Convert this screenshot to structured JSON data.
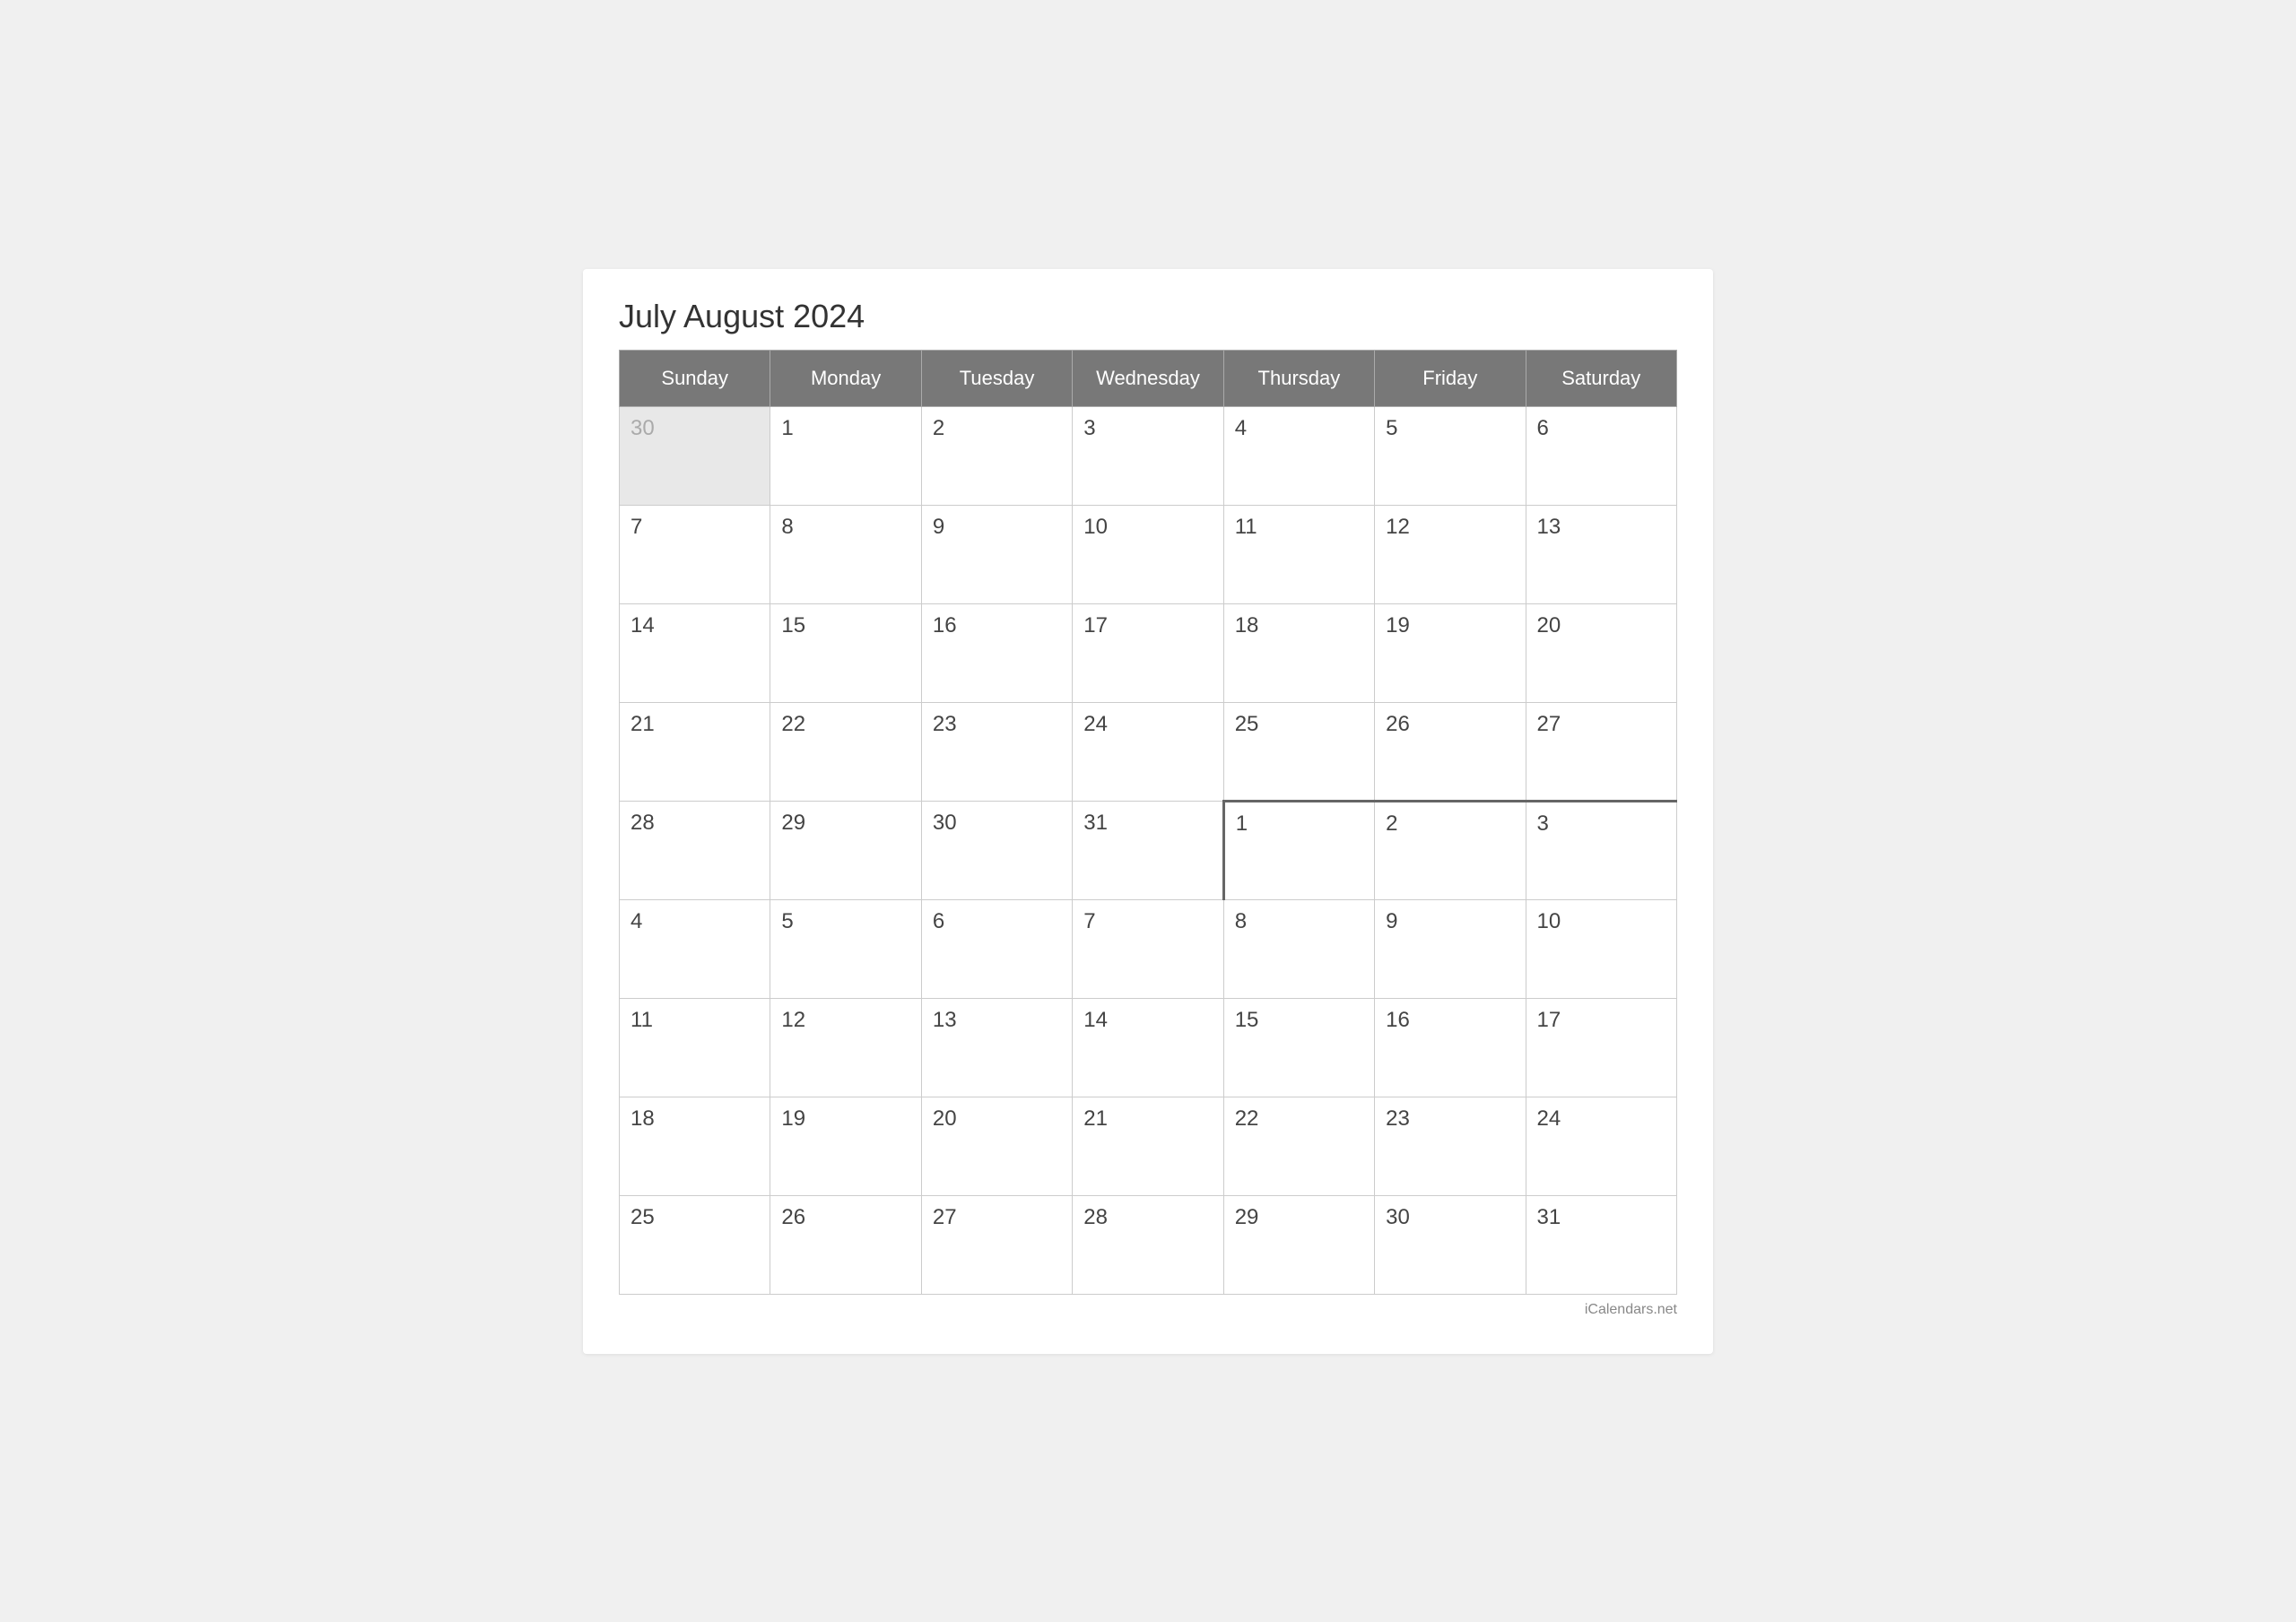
{
  "title": "July August 2024",
  "watermark": "iCalendars.net",
  "headers": [
    "Sunday",
    "Monday",
    "Tuesday",
    "Wednesday",
    "Thursday",
    "Friday",
    "Saturday"
  ],
  "weeks": [
    {
      "days": [
        {
          "num": "30",
          "type": "prev-month"
        },
        {
          "num": "1",
          "type": "current"
        },
        {
          "num": "2",
          "type": "current"
        },
        {
          "num": "3",
          "type": "current"
        },
        {
          "num": "4",
          "type": "current"
        },
        {
          "num": "5",
          "type": "current"
        },
        {
          "num": "6",
          "type": "current"
        }
      ]
    },
    {
      "days": [
        {
          "num": "7",
          "type": "current"
        },
        {
          "num": "8",
          "type": "current"
        },
        {
          "num": "9",
          "type": "current"
        },
        {
          "num": "10",
          "type": "current"
        },
        {
          "num": "11",
          "type": "current"
        },
        {
          "num": "12",
          "type": "current"
        },
        {
          "num": "13",
          "type": "current"
        }
      ]
    },
    {
      "days": [
        {
          "num": "14",
          "type": "current"
        },
        {
          "num": "15",
          "type": "current"
        },
        {
          "num": "16",
          "type": "current"
        },
        {
          "num": "17",
          "type": "current"
        },
        {
          "num": "18",
          "type": "current"
        },
        {
          "num": "19",
          "type": "current"
        },
        {
          "num": "20",
          "type": "current"
        }
      ]
    },
    {
      "days": [
        {
          "num": "21",
          "type": "current"
        },
        {
          "num": "22",
          "type": "current"
        },
        {
          "num": "23",
          "type": "current"
        },
        {
          "num": "24",
          "type": "current"
        },
        {
          "num": "25",
          "type": "current"
        },
        {
          "num": "26",
          "type": "current"
        },
        {
          "num": "27",
          "type": "current"
        }
      ]
    },
    {
      "days": [
        {
          "num": "28",
          "type": "current"
        },
        {
          "num": "29",
          "type": "current"
        },
        {
          "num": "30",
          "type": "current"
        },
        {
          "num": "31",
          "type": "current",
          "divider-right": true
        },
        {
          "num": "1",
          "type": "next-month",
          "divider-top": true
        },
        {
          "num": "2",
          "type": "next-month",
          "divider-top": true
        },
        {
          "num": "3",
          "type": "next-month",
          "divider-top": true
        }
      ]
    },
    {
      "days": [
        {
          "num": "4",
          "type": "next-month"
        },
        {
          "num": "5",
          "type": "next-month"
        },
        {
          "num": "6",
          "type": "next-month"
        },
        {
          "num": "7",
          "type": "next-month"
        },
        {
          "num": "8",
          "type": "next-month"
        },
        {
          "num": "9",
          "type": "next-month"
        },
        {
          "num": "10",
          "type": "next-month"
        }
      ]
    },
    {
      "days": [
        {
          "num": "11",
          "type": "next-month"
        },
        {
          "num": "12",
          "type": "next-month"
        },
        {
          "num": "13",
          "type": "next-month"
        },
        {
          "num": "14",
          "type": "next-month"
        },
        {
          "num": "15",
          "type": "next-month"
        },
        {
          "num": "16",
          "type": "next-month"
        },
        {
          "num": "17",
          "type": "next-month"
        }
      ]
    },
    {
      "days": [
        {
          "num": "18",
          "type": "next-month"
        },
        {
          "num": "19",
          "type": "next-month"
        },
        {
          "num": "20",
          "type": "next-month"
        },
        {
          "num": "21",
          "type": "next-month"
        },
        {
          "num": "22",
          "type": "next-month"
        },
        {
          "num": "23",
          "type": "next-month"
        },
        {
          "num": "24",
          "type": "next-month"
        }
      ]
    },
    {
      "days": [
        {
          "num": "25",
          "type": "next-month"
        },
        {
          "num": "26",
          "type": "next-month"
        },
        {
          "num": "27",
          "type": "next-month"
        },
        {
          "num": "28",
          "type": "next-month"
        },
        {
          "num": "29",
          "type": "next-month"
        },
        {
          "num": "30",
          "type": "next-month"
        },
        {
          "num": "31",
          "type": "next-month"
        }
      ]
    }
  ]
}
